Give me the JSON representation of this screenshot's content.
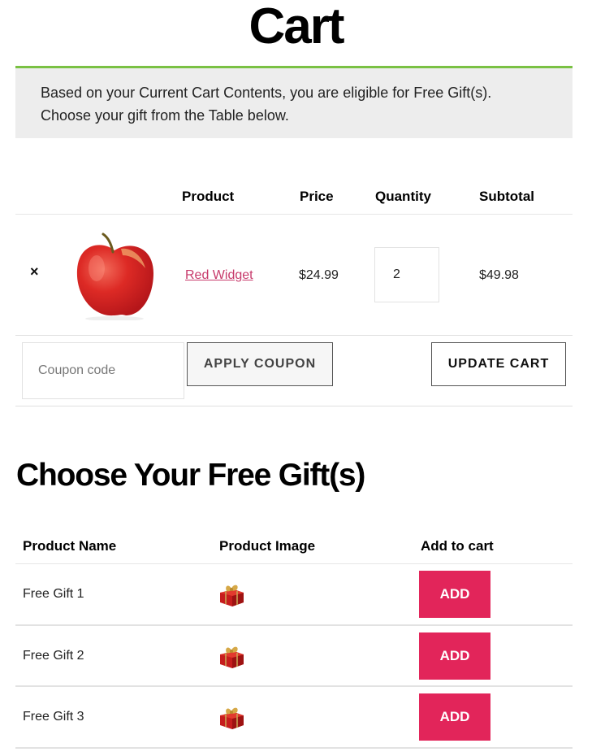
{
  "page": {
    "title": "Cart"
  },
  "notice": {
    "line1": "Based on your Current Cart Contents, you are eligible for Free Gift(s).",
    "line2": "Choose your gift from the Table below.",
    "accent_color": "#7ac143"
  },
  "cart": {
    "columns": {
      "product": "Product",
      "price": "Price",
      "quantity": "Quantity",
      "subtotal": "Subtotal"
    },
    "items": [
      {
        "remove_icon": "×",
        "image": "apple-icon",
        "name": "Red Widget",
        "price": "$24.99",
        "quantity": "2",
        "subtotal": "$49.98"
      }
    ],
    "coupon": {
      "placeholder": "Coupon code",
      "value": ""
    },
    "apply_coupon_label": "APPLY COUPON",
    "update_cart_label": "UPDATE CART"
  },
  "gifts": {
    "title": "Choose Your Free Gift(s)",
    "columns": {
      "name": "Product Name",
      "image": "Product Image",
      "add": "Add to cart"
    },
    "button_color": "#e2255a",
    "items": [
      {
        "name": "Free Gift 1",
        "image": "gift-box-icon",
        "add_label": "ADD"
      },
      {
        "name": "Free Gift 2",
        "image": "gift-box-icon",
        "add_label": "ADD"
      },
      {
        "name": "Free Gift 3",
        "image": "gift-box-icon",
        "add_label": "ADD"
      }
    ]
  }
}
